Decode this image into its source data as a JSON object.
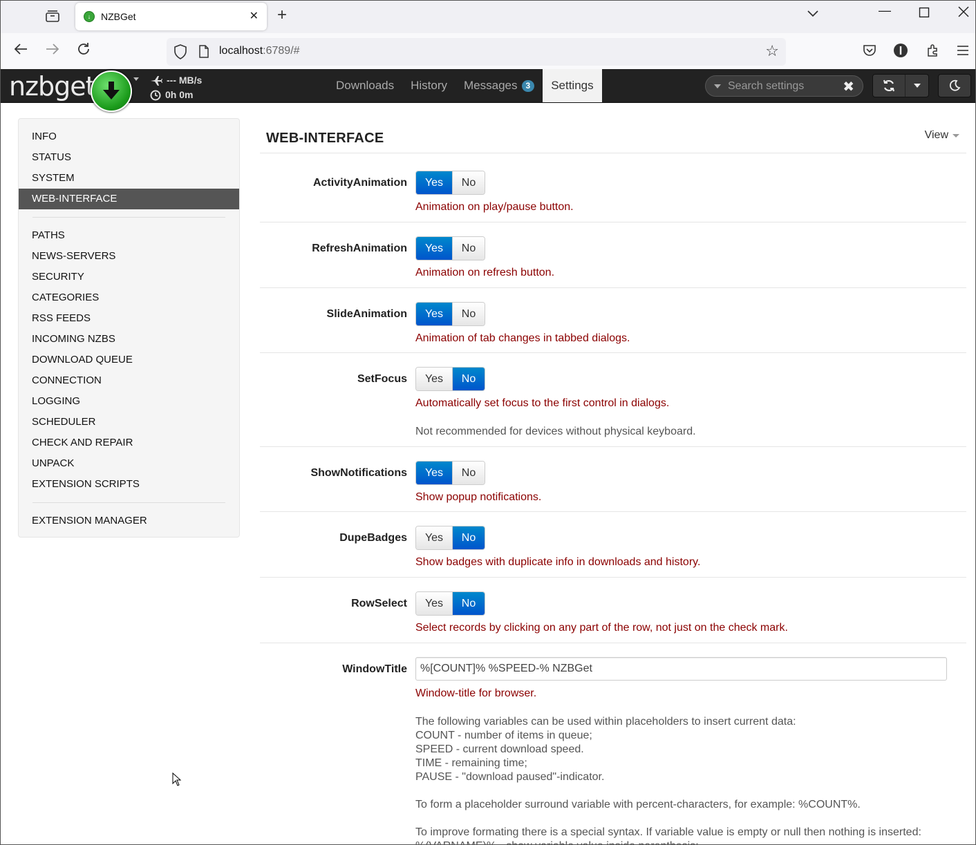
{
  "browser": {
    "tab_title": "NZBGet",
    "url_host": "localhost",
    "url_rest": ":6789/#"
  },
  "app": {
    "logo": "nzbget",
    "speed": "--- MB/s",
    "time": "0h 0m",
    "nav": {
      "downloads": "Downloads",
      "history": "History",
      "messages": "Messages",
      "messages_count": "3",
      "settings": "Settings"
    },
    "search_placeholder": "Search settings"
  },
  "sidebar": {
    "group1": [
      "INFO",
      "STATUS",
      "SYSTEM",
      "WEB-INTERFACE"
    ],
    "group2": [
      "PATHS",
      "NEWS-SERVERS",
      "SECURITY",
      "CATEGORIES",
      "RSS FEEDS",
      "INCOMING NZBS",
      "DOWNLOAD QUEUE",
      "CONNECTION",
      "LOGGING",
      "SCHEDULER",
      "CHECK AND REPAIR",
      "UNPACK",
      "EXTENSION SCRIPTS"
    ],
    "group3": [
      "EXTENSION MANAGER"
    ],
    "active": "WEB-INTERFACE"
  },
  "section": {
    "title": "WEB-INTERFACE",
    "view_label": "View"
  },
  "toggle_labels": {
    "yes": "Yes",
    "no": "No"
  },
  "options": [
    {
      "name": "ActivityAnimation",
      "value": "Yes",
      "desc": "Animation on play/pause button."
    },
    {
      "name": "RefreshAnimation",
      "value": "Yes",
      "desc": "Animation on refresh button."
    },
    {
      "name": "SlideAnimation",
      "value": "Yes",
      "desc": "Animation of tab changes in tabbed dialogs."
    },
    {
      "name": "SetFocus",
      "value": "No",
      "desc": "Automatically set focus to the first control in dialogs.",
      "note": "Not recommended for devices without physical keyboard."
    },
    {
      "name": "ShowNotifications",
      "value": "Yes",
      "desc": "Show popup notifications."
    },
    {
      "name": "DupeBadges",
      "value": "No",
      "desc": "Show badges with duplicate info in downloads and history."
    },
    {
      "name": "RowSelect",
      "value": "No",
      "desc": "Select records by clicking on any part of the row, not just on the check mark."
    }
  ],
  "window_title": {
    "name": "WindowTitle",
    "value": "%[COUNT]% %SPEED-% NZBGet",
    "desc": "Window-title for browser.",
    "notes": [
      "The following variables can be used within placeholders to insert current data:",
      "COUNT - number of items in queue;",
      "SPEED - current download speed.",
      "TIME - remaining time;",
      "PAUSE - \"download paused\"-indicator.",
      "To form a placeholder surround variable with percent-characters, for example: %COUNT%.",
      "To improve formating there is a special syntax. If variable value is empty or null then nothing is inserted:",
      "%(VARNAME)% - show variable value inside parenthesis;"
    ]
  }
}
